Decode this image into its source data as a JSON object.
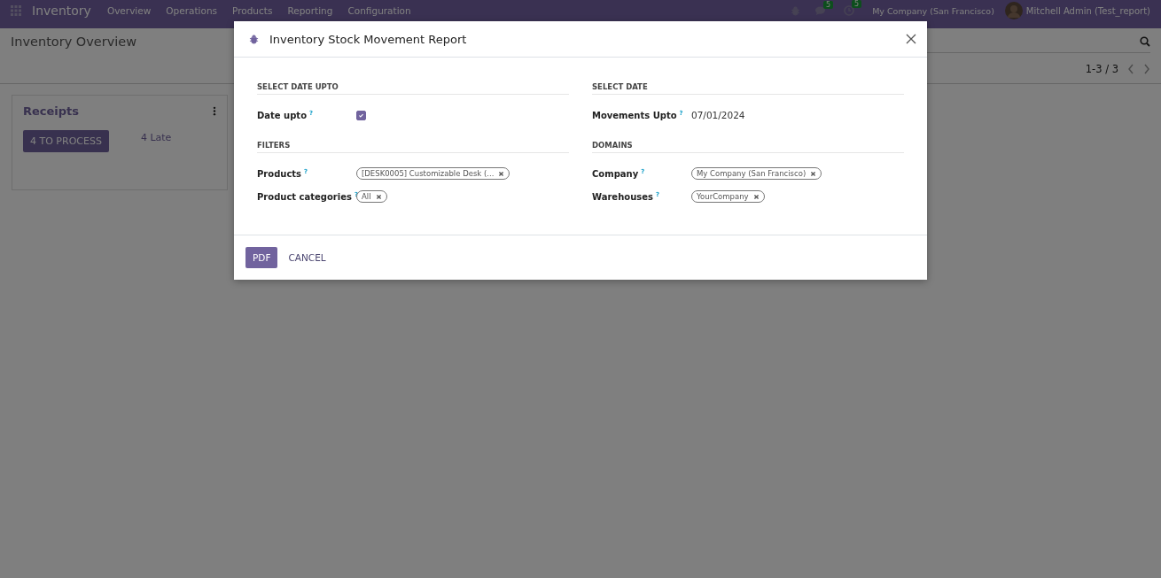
{
  "navbar": {
    "app_name": "Inventory",
    "menu": [
      "Overview",
      "Operations",
      "Products",
      "Reporting",
      "Configuration"
    ],
    "messages_count": "5",
    "activities_count": "5",
    "company": "My Company (San Francisco)",
    "user": "Mitchell Admin (Test_report)"
  },
  "control_panel": {
    "title": "Inventory Overview",
    "pager": "1-3 / 3"
  },
  "cards": [
    {
      "title": "Receipts",
      "button": "4 TO PROCESS",
      "late": "4 Late"
    }
  ],
  "dialog": {
    "title": "Inventory Stock Movement Report",
    "sections": [
      {
        "heading": "SELECT DATE UPTO",
        "fields": [
          {
            "label": "Date upto",
            "help": "?",
            "kind": "checkbox",
            "checked": true
          }
        ]
      },
      {
        "heading": "SELECT DATE",
        "fields": [
          {
            "label": "Movements Upto",
            "help": "?",
            "kind": "text",
            "value": "07/01/2024"
          }
        ]
      },
      {
        "heading": "FILTERS",
        "fields": [
          {
            "label": "Products",
            "help": "?",
            "kind": "tags",
            "tags": [
              "[DESK0005] Customizable Desk (..."
            ]
          },
          {
            "label": "Product categories",
            "help": "?",
            "kind": "tags",
            "tags": [
              "All"
            ]
          }
        ]
      },
      {
        "heading": "DOMAINS",
        "fields": [
          {
            "label": "Company",
            "help": "?",
            "kind": "tags",
            "tags": [
              "My Company (San Francisco)"
            ]
          },
          {
            "label": "Warehouses",
            "help": "?",
            "kind": "tags",
            "tags": [
              "YourCompany"
            ]
          }
        ]
      }
    ],
    "buttons": [
      {
        "label": "PDF",
        "kind": "primary"
      },
      {
        "label": "CANCEL",
        "kind": "secondary"
      }
    ]
  }
}
